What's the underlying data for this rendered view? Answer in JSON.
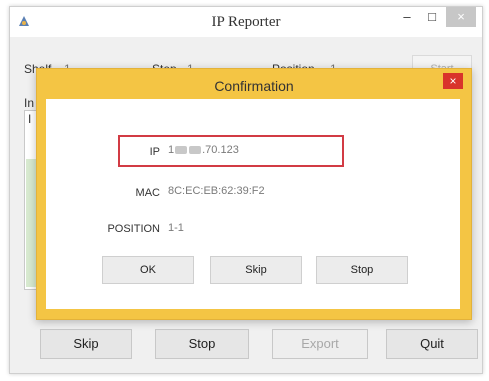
{
  "window": {
    "title": "IP Reporter",
    "minimize_glyph": "–",
    "maximize_glyph": "□",
    "close_glyph": "×"
  },
  "fields": {
    "shelf_label": "Shelf",
    "shelf_value": "1",
    "step_label": "Step",
    "step_value": "1",
    "position_label": "Position",
    "position_value": "1",
    "start_label": "Start"
  },
  "info": {
    "label_fragment": "In",
    "box_fragment": "I"
  },
  "bottom_buttons": {
    "skip": "Skip",
    "stop": "Stop",
    "export": "Export",
    "quit": "Quit"
  },
  "dialog": {
    "title": "Confirmation",
    "close_glyph": "×",
    "ip_label": "IP",
    "ip_value_prefix": "1",
    "ip_value_suffix": ".70.123",
    "mac_label": "MAC",
    "mac_value": "8C:EC:EB:62:39:F2",
    "position_label": "POSITION",
    "position_value": "1-1",
    "ok_label": "OK",
    "skip_label": "Skip",
    "stop_label": "Stop"
  },
  "colors": {
    "dialog_accent": "#f4c544",
    "dialog_close": "#d9342b",
    "ip_highlight_border": "#d23b44"
  }
}
